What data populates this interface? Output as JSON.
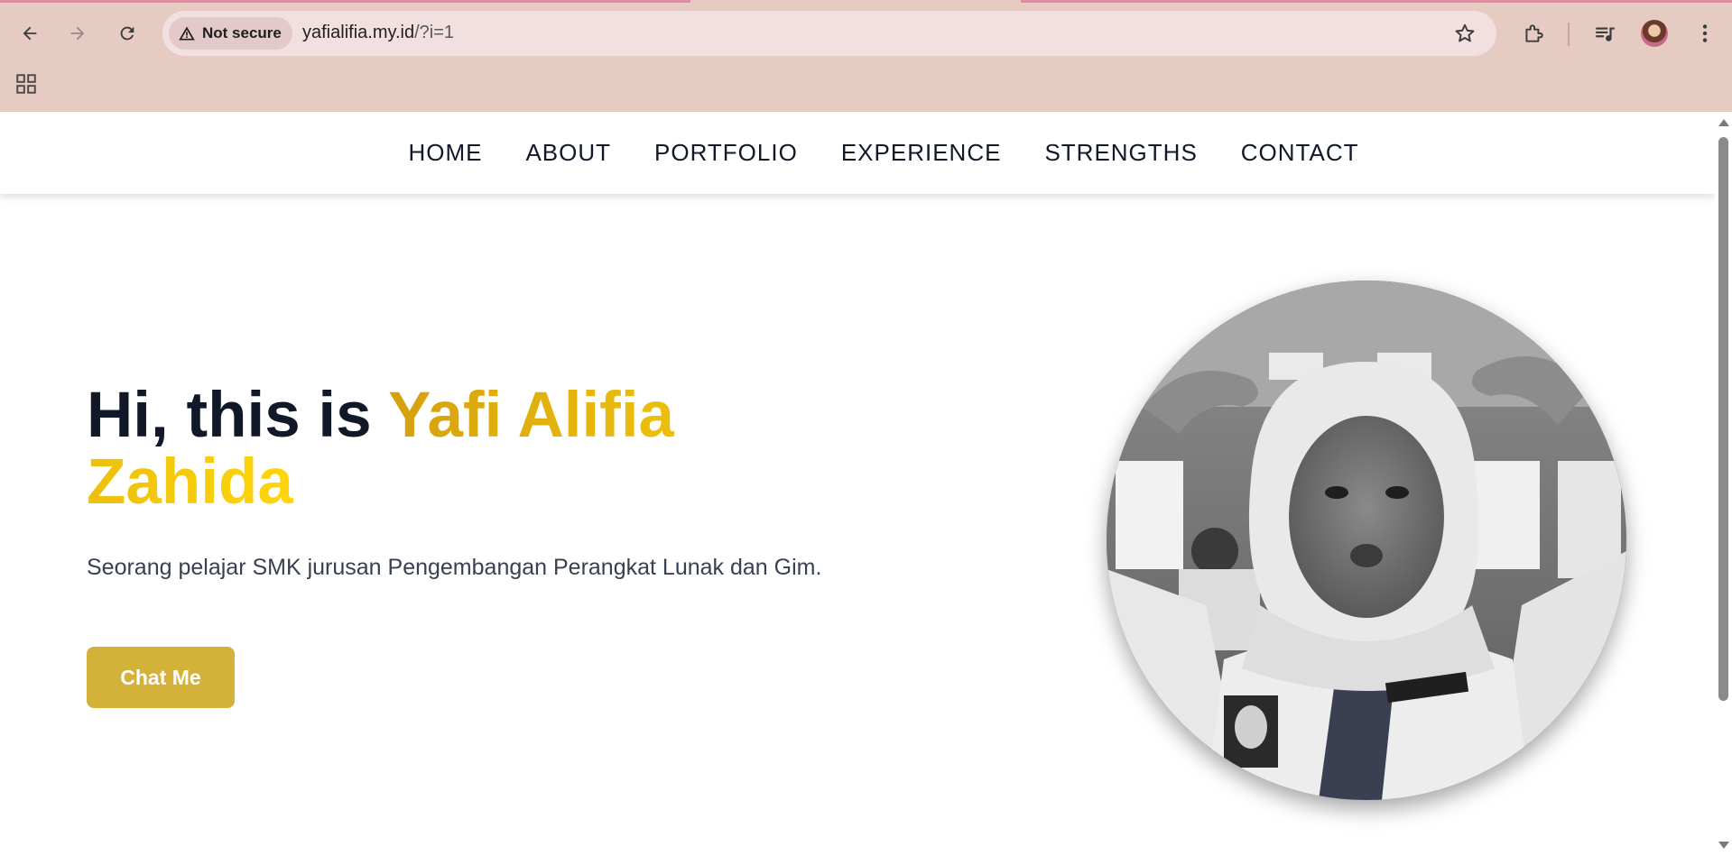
{
  "browser": {
    "security_label": "Not secure",
    "url_host": "yafialifia.my.id",
    "url_path": "/?i=1"
  },
  "nav": {
    "items": [
      "HOME",
      "ABOUT",
      "PORTFOLIO",
      "EXPERIENCE",
      "STRENGTHS",
      "CONTACT"
    ]
  },
  "hero": {
    "greeting": "Hi, this is ",
    "name": "Yafi Alifia Zahida",
    "description": "Seorang pelajar SMK jurusan Pengembangan Perangkat Lunak dan Gim.",
    "cta_label": "Chat Me",
    "photo": "grayscale portrait of a student in white hijab making peace-sign hand gestures"
  },
  "colors": {
    "accent_gold": "#d4b23a",
    "highlight_start": "#d4a00f",
    "highlight_end": "#ffd60a",
    "text_dark": "#111827",
    "chrome_bg": "#e6cbc2"
  }
}
